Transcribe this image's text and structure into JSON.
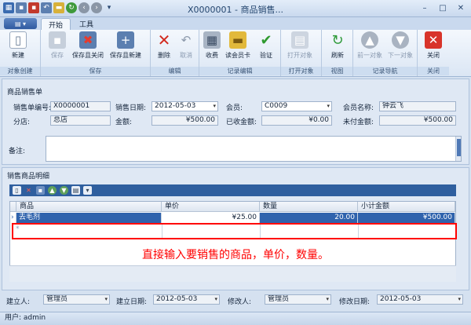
{
  "window": {
    "title": "X0000001 - 商品销售..."
  },
  "tabs": {
    "active": "开始",
    "tools": "工具"
  },
  "ribbon": {
    "new": "新建",
    "save": "保存",
    "save_close": "保存且关闭",
    "save_new": "保存且新建",
    "delete": "删除",
    "cancel": "取消",
    "collect": "收费",
    "read_card": "读会员卡",
    "verify": "验证",
    "open_object": "打开对象",
    "refresh": "刷新",
    "prev": "前一对象",
    "next": "下一对象",
    "close": "关闭",
    "groups": {
      "create": "对象创建",
      "save": "保存",
      "edit": "编辑",
      "record_edit": "记录编辑",
      "open": "打开对象",
      "view": "视图",
      "nav": "记录导航",
      "close": "关闭"
    }
  },
  "form": {
    "section_title": "商品销售单",
    "order_no_label": "销售单编号:",
    "order_no": "X0000001",
    "sale_date_label": "销售日期:",
    "sale_date": "2012-05-03",
    "member_label": "会员:",
    "member": "C0009",
    "member_name_label": "会员名称:",
    "member_name": "钟云飞",
    "store_label": "分店:",
    "store": "总店",
    "amount_label": "金额:",
    "amount": "¥500.00",
    "received_label": "已收金额:",
    "received": "¥0.00",
    "unpaid_label": "未付金额:",
    "unpaid": "¥500.00",
    "remark_label": "备注:"
  },
  "detail": {
    "section_title": "销售商品明细",
    "columns": [
      "商品",
      "单价",
      "数量",
      "小计金额"
    ],
    "rows": [
      {
        "product": "去毛剂",
        "price": "¥25.00",
        "qty": "20.00",
        "subtotal": "¥500.00"
      }
    ],
    "hint": "直接输入要销售的商品，单价，数量。"
  },
  "footer": {
    "creator_label": "建立人:",
    "creator": "管理员",
    "created_label": "建立日期:",
    "created": "2012-05-03",
    "modifier_label": "修改人:",
    "modifier": "管理员",
    "modified_label": "修改日期:",
    "modified": "2012-05-03"
  },
  "status": {
    "user": "用户: admin"
  },
  "colors": {
    "accent": "#2f5f9f",
    "selected_row": "#2f63ad",
    "hint": "#ff0000"
  }
}
